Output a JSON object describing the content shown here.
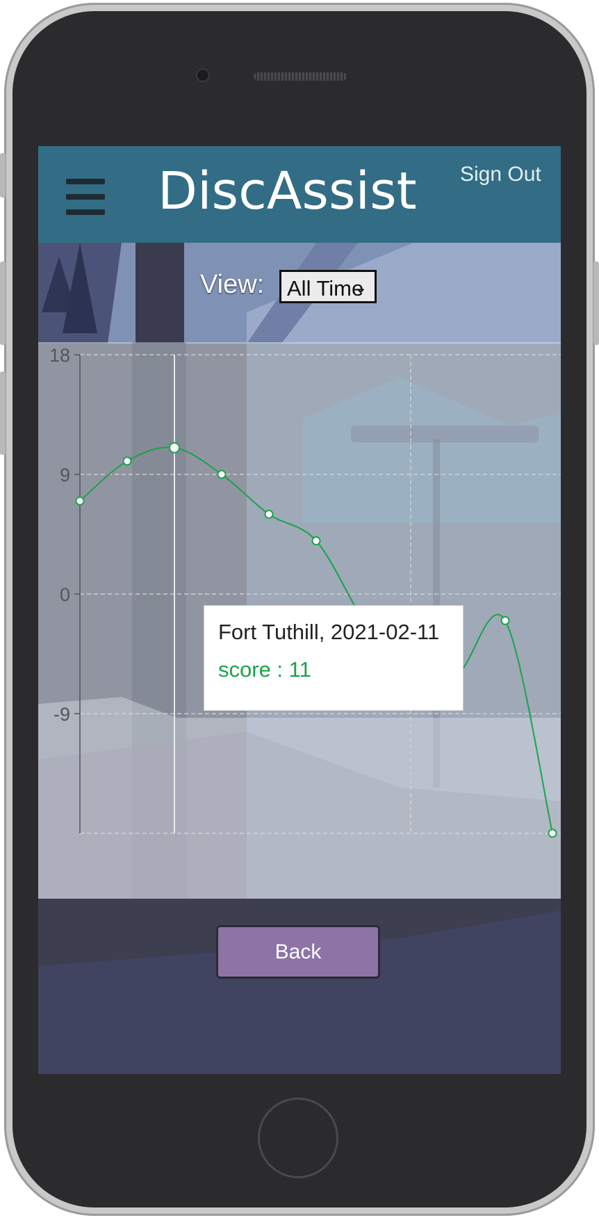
{
  "app": {
    "title": "DiscAssist",
    "sign_out_label": "Sign Out",
    "menu_icon": "hamburger-menu-icon"
  },
  "filters": {
    "view_label": "View:",
    "view_selected": "All Time"
  },
  "tooltip": {
    "label": "Fort Tuthill, 2021-02-11",
    "value_text": "score : 11"
  },
  "actions": {
    "back_label": "Back"
  },
  "colors": {
    "header_bg": "#326d85",
    "line": "#1aa34a",
    "back_button": "#8e73a7"
  },
  "chart_data": {
    "type": "line",
    "title": "",
    "xlabel": "",
    "ylabel": "",
    "ylim": [
      -18,
      18
    ],
    "yticks": [
      18,
      9,
      0,
      -9
    ],
    "grid": true,
    "series": [
      {
        "values": [
          7,
          10,
          11,
          9,
          6,
          4,
          -2,
          -7,
          -6,
          -2,
          -18
        ]
      }
    ],
    "highlight_index": 2
  }
}
